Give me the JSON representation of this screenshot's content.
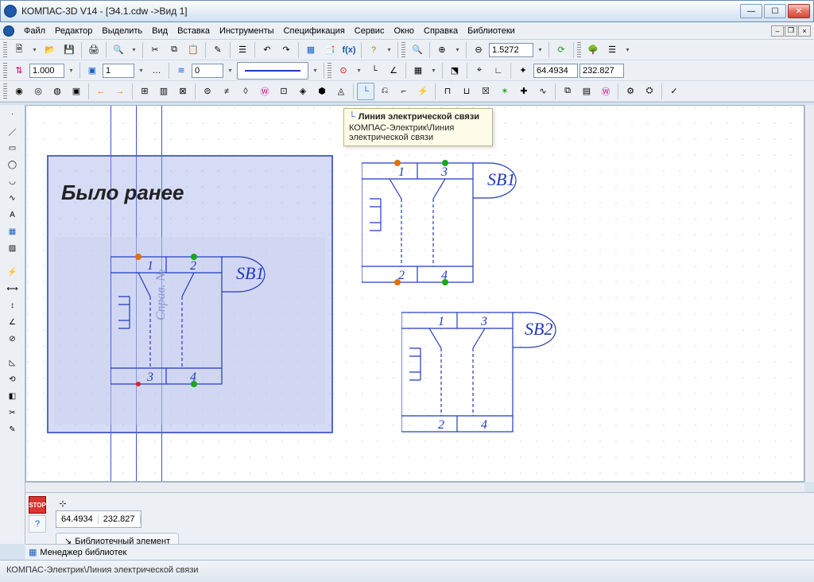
{
  "window": {
    "title": "КОМПАС-3D V14 - [Э4.1.cdw ->Вид 1]"
  },
  "menu": {
    "file": "Файл",
    "editor": "Редактор",
    "select": "Выделить",
    "view": "Вид",
    "insert": "Вставка",
    "tools": "Инструменты",
    "spec": "Спецификация",
    "service": "Сервис",
    "window": "Окно",
    "help": "Справка",
    "libs": "Библиотеки"
  },
  "toolbar1": {
    "zoom_value": "1.5272"
  },
  "toolbar2": {
    "scale": "1.000",
    "layer": "1",
    "style_idx": "0",
    "coord_x": "64.4934",
    "coord_y": "232.827"
  },
  "tooltip": {
    "title": "Линия электрической связи",
    "body": "КОМПАС-Электрик\\Линия электрической связи"
  },
  "canvas": {
    "prev_title": "Было ранее",
    "sb1": "SB1",
    "sb2": "SB2",
    "pin1": "1",
    "pin2": "2",
    "pin3": "3",
    "pin4": "4",
    "sprav": "Справ. №"
  },
  "props": {
    "coord_x": "64.4934",
    "coord_y": "232.827",
    "tab_label": "Библиотечный элемент"
  },
  "lib_manager": {
    "label": "Менеджер библиотек"
  },
  "status": {
    "text": "КОМПАС-Электрик\\Линия электрической связи"
  }
}
